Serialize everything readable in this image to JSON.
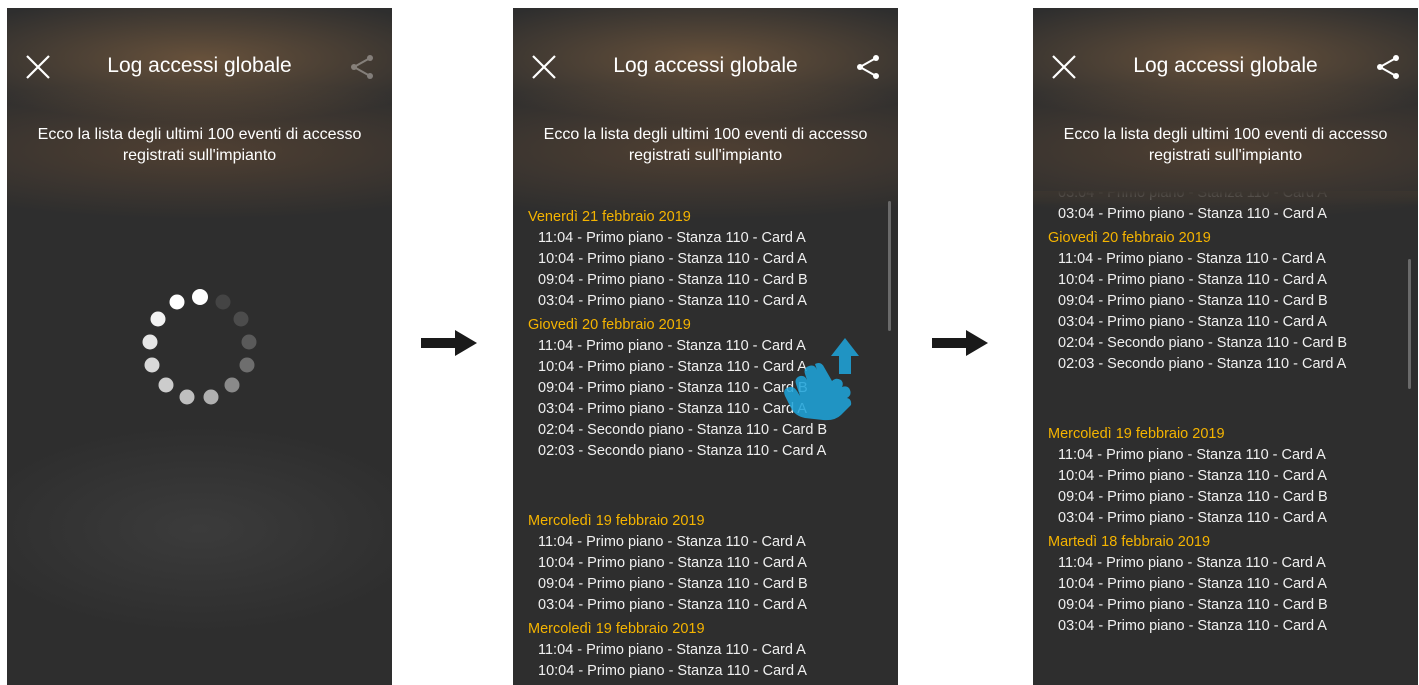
{
  "screens": [
    {
      "title": "Log accessi globale",
      "subtitle": "Ecco la lista degli ultimi 100 eventi di accesso registrati sull'impianto",
      "state": "loading"
    },
    {
      "title": "Log accessi globale",
      "subtitle": "Ecco la lista degli ultimi 100 eventi di accesso registrati sull'impianto",
      "state": "list"
    },
    {
      "title": "Log accessi globale",
      "subtitle": "Ecco la lista degli ultimi 100 eventi di accesso registrati sull'impianto",
      "state": "list-scrolled"
    }
  ],
  "icons": {
    "close": "close-icon",
    "share": "share-icon",
    "spinner": "loading-spinner-icon",
    "swipe": "swipe-up-hand-icon",
    "next": "right-arrow-icon"
  },
  "colors": {
    "background": "#2e2e2e",
    "day_title": "#f5b400",
    "entry": "#f0f0f0",
    "swipe": "#1fa3d8"
  },
  "screen2": {
    "days": [
      {
        "title": "Venerdì 21 febbraio 2019",
        "entries": [
          "11:04 - Primo piano - Stanza 110 - Card A",
          "10:04 - Primo piano - Stanza 110 - Card A",
          "09:04 - Primo piano - Stanza 110 - Card B",
          "03:04 - Primo piano - Stanza 110 - Card A"
        ]
      },
      {
        "title": "Giovedì 20 febbraio 2019",
        "entries": [
          "11:04 - Primo piano - Stanza 110 - Card A",
          "10:04 - Primo piano - Stanza 110 - Card A",
          "09:04 - Primo piano - Stanza 110 - Card B",
          "03:04 - Primo piano - Stanza 110 - Card A",
          "02:04 - Secondo piano - Stanza 110 - Card B",
          "02:03 - Secondo piano - Stanza 110 - Card A"
        ]
      },
      {
        "title": "Mercoledì 19 febbraio 2019",
        "entries": [
          "11:04 - Primo piano - Stanza 110 - Card A",
          "10:04 - Primo piano - Stanza 110 - Card A",
          "09:04 - Primo piano - Stanza 110 - Card B",
          "03:04 - Primo piano - Stanza 110 - Card A"
        ]
      },
      {
        "title": "Mercoledì 19 febbraio 2019",
        "entries": [
          "11:04 - Primo piano - Stanza 110 - Card A",
          "10:04 - Primo piano - Stanza 110 - Card A"
        ]
      }
    ]
  },
  "screen3": {
    "partial_entry": "03:04 - Primo piano - Stanza 110 - Card A",
    "days": [
      {
        "title": "Giovedì 20 febbraio 2019",
        "entries": [
          "11:04 - Primo piano - Stanza 110 - Card A",
          "10:04 - Primo piano - Stanza 110 - Card A",
          "09:04 - Primo piano - Stanza 110 - Card B",
          "03:04 - Primo piano - Stanza 110 - Card A",
          "02:04 - Secondo piano - Stanza 110 - Card B",
          "02:03 - Secondo piano - Stanza 110 - Card A"
        ]
      },
      {
        "title": "Mercoledì 19 febbraio 2019",
        "entries": [
          "11:04 - Primo piano - Stanza 110 - Card A",
          "10:04 - Primo piano - Stanza 110 - Card A",
          "09:04 - Primo piano - Stanza 110 - Card B",
          "03:04 - Primo piano - Stanza 110 - Card A"
        ]
      },
      {
        "title": "Martedì 18 febbraio 2019",
        "entries": [
          "11:04 - Primo piano - Stanza 110 - Card A",
          "10:04 - Primo piano - Stanza 110 - Card A",
          "09:04 - Primo piano - Stanza 110 - Card B",
          "03:04 - Primo piano - Stanza 110 - Card A"
        ]
      }
    ]
  }
}
